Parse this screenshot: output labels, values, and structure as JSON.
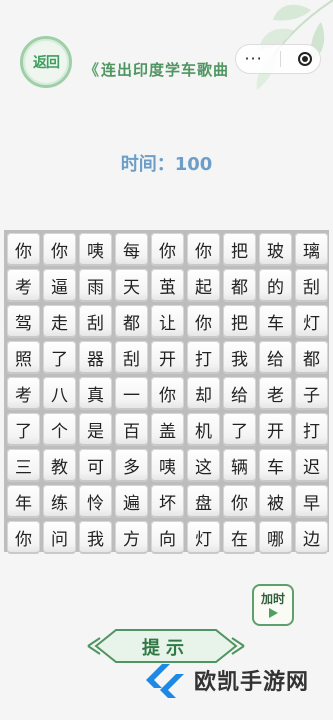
{
  "header": {
    "back_label": "返回",
    "title_deco": "《",
    "title": "连出印度学车歌曲",
    "menu_dots": "···"
  },
  "timer": {
    "text": "时间：100"
  },
  "grid": [
    [
      "你",
      "你",
      "咦",
      "每",
      "你",
      "你",
      "把",
      "玻",
      "璃"
    ],
    [
      "考",
      "逼",
      "雨",
      "天",
      "茧",
      "起",
      "都",
      "的",
      "刮"
    ],
    [
      "驾",
      "走",
      "刮",
      "都",
      "让",
      "你",
      "把",
      "车",
      "灯"
    ],
    [
      "照",
      "了",
      "器",
      "刮",
      "开",
      "打",
      "我",
      "给",
      "都"
    ],
    [
      "考",
      "八",
      "真",
      "一",
      "你",
      "却",
      "给",
      "老",
      "子"
    ],
    [
      "了",
      "个",
      "是",
      "百",
      "盖",
      "机",
      "了",
      "开",
      "打"
    ],
    [
      "三",
      "教",
      "可",
      "多",
      "咦",
      "这",
      "辆",
      "车",
      "迟"
    ],
    [
      "年",
      "练",
      "怜",
      "遍",
      "坏",
      "盘",
      "你",
      "被",
      "早"
    ],
    [
      "你",
      "问",
      "我",
      "方",
      "向",
      "灯",
      "在",
      "哪",
      "边"
    ]
  ],
  "boost": {
    "label": "加时"
  },
  "bottom": {
    "label": "提示"
  },
  "watermark": {
    "text": "欧凯手游网"
  },
  "colors": {
    "accent_green": "#4e9561",
    "timer_blue": "#6c9ec8",
    "board_gray": "#bdbdbd"
  }
}
